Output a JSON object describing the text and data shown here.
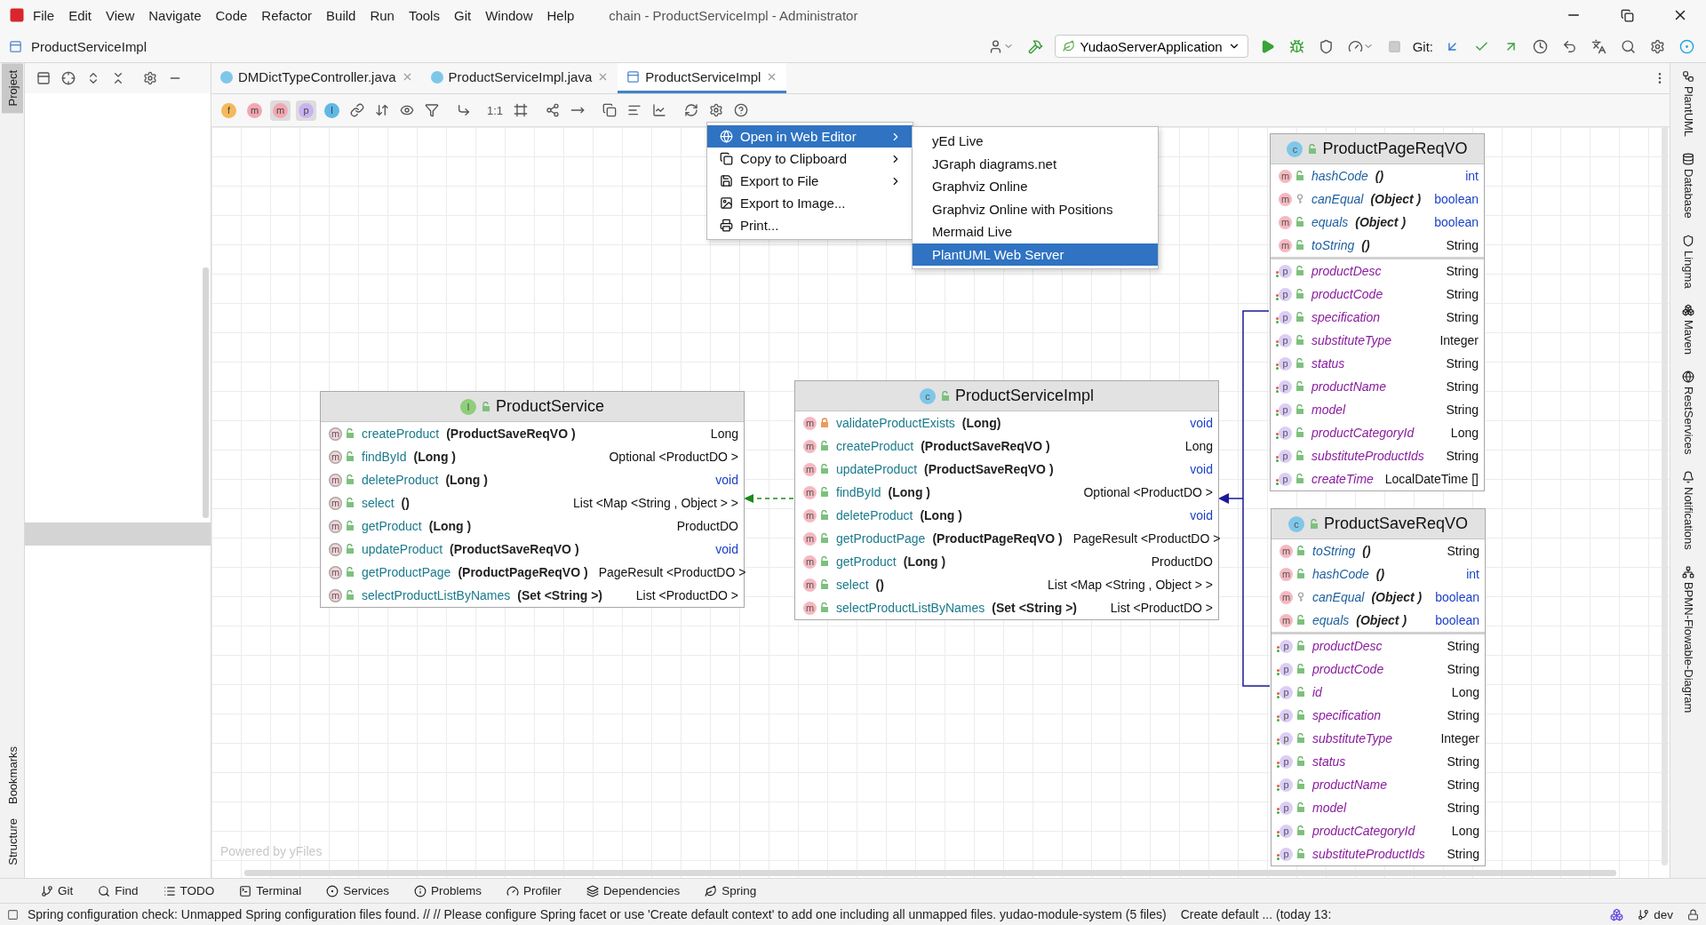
{
  "menu_bar": {
    "items": [
      "File",
      "Edit",
      "View",
      "Navigate",
      "Code",
      "Refactor",
      "Build",
      "Run",
      "Tools",
      "Git",
      "Window",
      "Help"
    ],
    "title": "chain - ProductServiceImpl - Administrator"
  },
  "nav_bar": {
    "breadcrumb": "ProductServiceImpl",
    "run_config": "YudaoServerApplication",
    "git_label": "Git:"
  },
  "left_strip": [
    {
      "label": "Project",
      "selected": true
    },
    {
      "label": "Bookmarks",
      "selected": false
    },
    {
      "label": "Structure",
      "selected": false
    }
  ],
  "right_strip": [
    "PlantUML",
    "Database",
    "Lingma",
    "Maven",
    "RestServices",
    "Notifications",
    "BPMN-Flowable-Diagram"
  ],
  "editor_tabs": [
    {
      "label": "DMDictTypeController.java",
      "kind": "class",
      "selected": false
    },
    {
      "label": "ProductServiceImpl.java",
      "kind": "class",
      "selected": false
    },
    {
      "label": "ProductServiceImpl",
      "kind": "diagram",
      "selected": true
    }
  ],
  "diagram_toolbar": {
    "filters": [
      {
        "glyph": "f",
        "color": "#f5b85a",
        "selected": false
      },
      {
        "glyph": "m",
        "color": "#f4a7b1",
        "selected": false
      },
      {
        "glyph": "m",
        "color": "#f4a7b1",
        "selected": true
      },
      {
        "glyph": "p",
        "color": "#c9b3f0",
        "selected": true
      },
      {
        "glyph": "I",
        "color": "#5fb8e6",
        "selected": false
      }
    ],
    "actual_size": "1:1"
  },
  "diagram": {
    "footer_note": "Powered by yFiles",
    "classes": [
      {
        "name": "ProductService",
        "kind": "interface",
        "badge": "I",
        "italic": false,
        "methods": [
          {
            "badge": "m",
            "name": "createProduct",
            "params": "(ProductSaveReqVO )",
            "type": "Long",
            "kind": "public",
            "primitive": false
          },
          {
            "badge": "m",
            "name": "findById",
            "params": "(Long )",
            "type": "Optional <ProductDO >",
            "kind": "public",
            "primitive": false
          },
          {
            "badge": "m",
            "name": "deleteProduct",
            "params": "(Long )",
            "type": "void",
            "kind": "public",
            "primitive": true
          },
          {
            "badge": "m",
            "name": "select",
            "params": "()",
            "type": "List <Map <String , Object > >",
            "kind": "public",
            "primitive": false
          },
          {
            "badge": "m",
            "name": "getProduct",
            "params": "(Long )",
            "type": "ProductDO",
            "kind": "public",
            "primitive": false
          },
          {
            "badge": "m",
            "name": "updateProduct",
            "params": "(ProductSaveReqVO )",
            "type": "void",
            "kind": "public",
            "primitive": true
          },
          {
            "badge": "m",
            "name": "getProductPage",
            "params": "(ProductPageReqVO )",
            "type": "PageResult <ProductDO >",
            "kind": "public",
            "primitive": false
          },
          {
            "badge": "m",
            "name": "selectProductListByNames",
            "params": "(Set <String >)",
            "type": "List <ProductDO >",
            "kind": "public",
            "primitive": false
          }
        ]
      },
      {
        "name": "ProductServiceImpl",
        "kind": "class",
        "badge": "c",
        "italic": false,
        "methods": [
          {
            "badge": "m",
            "name": "validateProductExists",
            "params": "(Long)",
            "type": "void",
            "kind": "private",
            "primitive": true
          },
          {
            "badge": "m",
            "name": "createProduct",
            "params": "(ProductSaveReqVO )",
            "type": "Long",
            "kind": "public",
            "primitive": false
          },
          {
            "badge": "m",
            "name": "updateProduct",
            "params": "(ProductSaveReqVO )",
            "type": "void",
            "kind": "public",
            "primitive": true
          },
          {
            "badge": "m",
            "name": "findById",
            "params": "(Long )",
            "type": "Optional <ProductDO >",
            "kind": "public",
            "primitive": false
          },
          {
            "badge": "m",
            "name": "deleteProduct",
            "params": "(Long )",
            "type": "void",
            "kind": "public",
            "primitive": true
          },
          {
            "badge": "m",
            "name": "getProductPage",
            "params": "(ProductPageReqVO )",
            "type": "PageResult <ProductDO >",
            "kind": "public",
            "primitive": false
          },
          {
            "badge": "m",
            "name": "getProduct",
            "params": "(Long )",
            "type": "ProductDO",
            "kind": "public",
            "primitive": false
          },
          {
            "badge": "m",
            "name": "select",
            "params": "()",
            "type": "List <Map <String , Object > >",
            "kind": "public",
            "primitive": false
          },
          {
            "badge": "m",
            "name": "selectProductListByNames",
            "params": "(Set <String >)",
            "type": "List <ProductDO >",
            "kind": "public",
            "primitive": false
          }
        ]
      },
      {
        "name": "ProductPageReqVO",
        "kind": "class",
        "badge": "c",
        "italic": true,
        "methods": [
          {
            "badge": "m",
            "name": "hashCode",
            "params": "()",
            "type": "int",
            "kind": "public",
            "primitive": true
          },
          {
            "badge": "m",
            "name": "canEqual",
            "params": "(Object )",
            "type": "boolean",
            "kind": "protected",
            "primitive": true
          },
          {
            "badge": "m",
            "name": "equals",
            "params": "(Object )",
            "type": "boolean",
            "kind": "public",
            "primitive": true
          },
          {
            "badge": "m",
            "name": "toString",
            "params": "()",
            "type": "String",
            "kind": "public",
            "primitive": false
          }
        ],
        "fields": [
          {
            "badge": "p",
            "name": "productDesc",
            "type": "String",
            "kind": "public",
            "primitive": false
          },
          {
            "badge": "p",
            "name": "productCode",
            "type": "String",
            "kind": "public",
            "primitive": false
          },
          {
            "badge": "p",
            "name": "specification",
            "type": "String",
            "kind": "public",
            "primitive": false
          },
          {
            "badge": "p",
            "name": "substituteType",
            "type": "Integer",
            "kind": "public",
            "primitive": false
          },
          {
            "badge": "p",
            "name": "status",
            "type": "String",
            "kind": "public",
            "primitive": false
          },
          {
            "badge": "p",
            "name": "productName",
            "type": "String",
            "kind": "public",
            "primitive": false
          },
          {
            "badge": "p",
            "name": "model",
            "type": "String",
            "kind": "public",
            "primitive": false
          },
          {
            "badge": "p",
            "name": "productCategoryId",
            "type": "Long",
            "kind": "public",
            "primitive": false
          },
          {
            "badge": "p",
            "name": "substituteProductIds",
            "type": "String",
            "kind": "public",
            "primitive": false
          },
          {
            "badge": "p",
            "name": "createTime",
            "type": "LocalDateTime []",
            "kind": "public",
            "primitive": false
          }
        ]
      },
      {
        "name": "ProductSaveReqVO",
        "kind": "class",
        "badge": "c",
        "italic": true,
        "methods": [
          {
            "badge": "m",
            "name": "toString",
            "params": "()",
            "type": "String",
            "kind": "public",
            "primitive": false
          },
          {
            "badge": "m",
            "name": "hashCode",
            "params": "()",
            "type": "int",
            "kind": "public",
            "primitive": true
          },
          {
            "badge": "m",
            "name": "canEqual",
            "params": "(Object )",
            "type": "boolean",
            "kind": "protected",
            "primitive": true
          },
          {
            "badge": "m",
            "name": "equals",
            "params": "(Object )",
            "type": "boolean",
            "kind": "public",
            "primitive": true
          }
        ],
        "fields": [
          {
            "badge": "p",
            "name": "productDesc",
            "type": "String",
            "kind": "public",
            "primitive": false
          },
          {
            "badge": "p",
            "name": "productCode",
            "type": "String",
            "kind": "public",
            "primitive": false
          },
          {
            "badge": "p",
            "name": "id",
            "type": "Long",
            "kind": "public",
            "primitive": false
          },
          {
            "badge": "p",
            "name": "specification",
            "type": "String",
            "kind": "public",
            "primitive": false
          },
          {
            "badge": "p",
            "name": "substituteType",
            "type": "Integer",
            "kind": "public",
            "primitive": false
          },
          {
            "badge": "p",
            "name": "status",
            "type": "String",
            "kind": "public",
            "primitive": false
          },
          {
            "badge": "p",
            "name": "productName",
            "type": "String",
            "kind": "public",
            "primitive": false
          },
          {
            "badge": "p",
            "name": "model",
            "type": "String",
            "kind": "public",
            "primitive": false
          },
          {
            "badge": "p",
            "name": "productCategoryId",
            "type": "Long",
            "kind": "public",
            "primitive": false
          },
          {
            "badge": "p",
            "name": "substituteProductIds",
            "type": "String",
            "kind": "public",
            "primitive": false
          }
        ]
      }
    ]
  },
  "context_menu": {
    "items": [
      {
        "label": "Open in Web Editor",
        "selected": true,
        "has_submenu": true
      },
      {
        "label": "Copy to Clipboard",
        "selected": false,
        "has_submenu": true
      },
      {
        "label": "Export to File",
        "selected": false,
        "has_submenu": true
      },
      {
        "label": "Export to Image...",
        "selected": false,
        "has_submenu": false
      },
      {
        "label": "Print...",
        "selected": false,
        "has_submenu": false
      }
    ],
    "submenu": [
      {
        "label": "yEd Live",
        "selected": false
      },
      {
        "label": "JGraph diagrams.net",
        "selected": false
      },
      {
        "label": "Graphviz Online",
        "selected": false
      },
      {
        "label": "Graphviz Online with Positions",
        "selected": false
      },
      {
        "label": "Mermaid Live",
        "selected": false
      },
      {
        "label": "PlantUML Web Server",
        "selected": true
      }
    ]
  },
  "tool_windows": [
    "Git",
    "Find",
    "TODO",
    "Terminal",
    "Services",
    "Problems",
    "Profiler",
    "Dependencies",
    "Spring"
  ],
  "status_bar": {
    "message": "Spring configuration check: Unmapped Spring configuration files found. // // Please configure Spring facet or use 'Create default context' to add one including all unmapped files. yudao-module-system (5 files)",
    "task": "Create default ... (today 13:",
    "branch": "dev"
  }
}
